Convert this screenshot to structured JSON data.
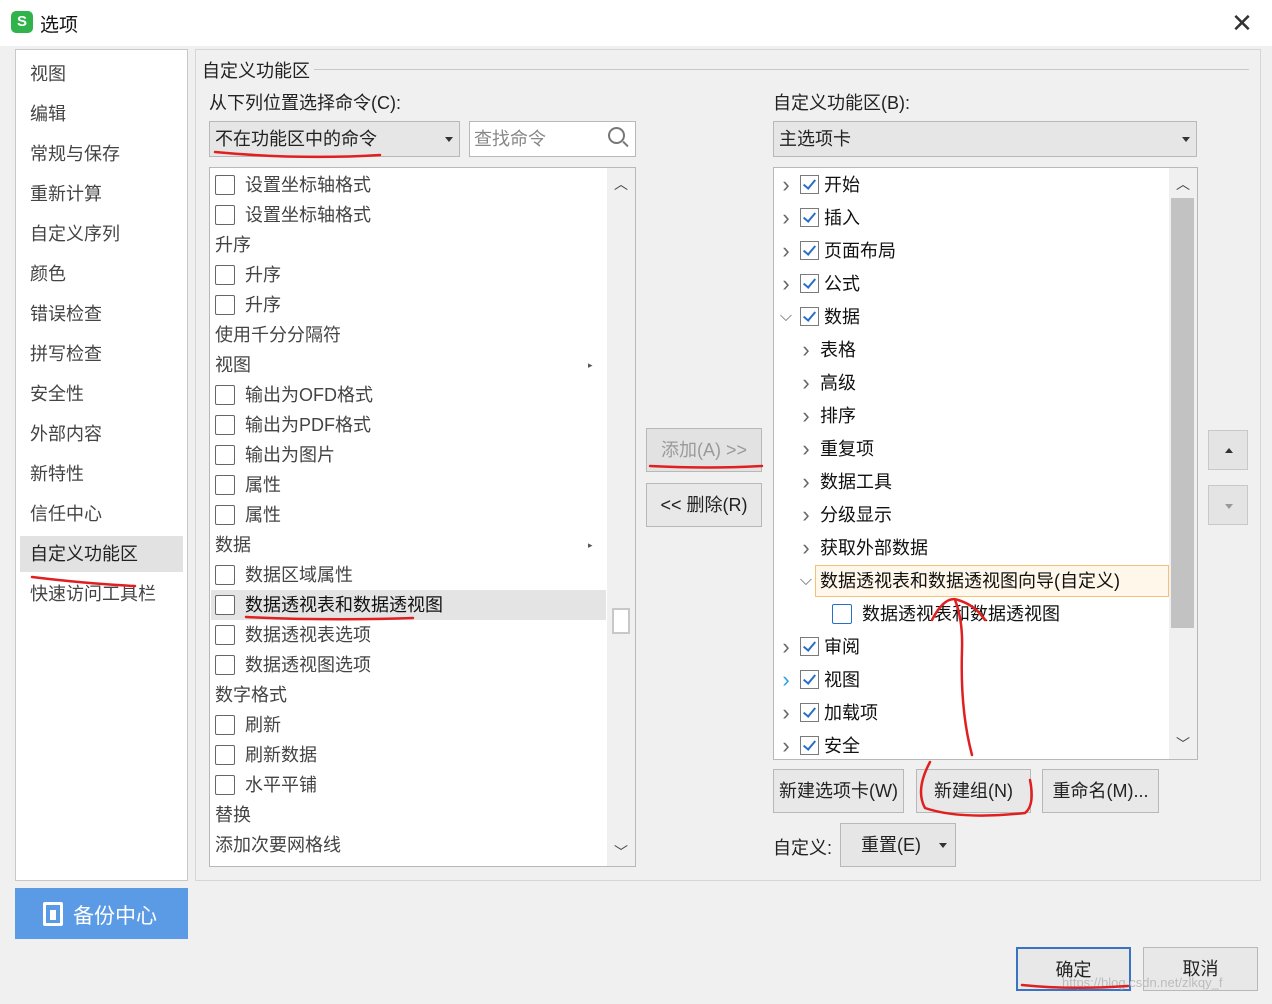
{
  "window": {
    "title": "选项",
    "app_icon_letter": "S",
    "close_glyph": "✕"
  },
  "nav": {
    "items": [
      "视图",
      "编辑",
      "常规与保存",
      "重新计算",
      "自定义序列",
      "颜色",
      "错误检查",
      "拼写检查",
      "安全性",
      "外部内容",
      "新特性",
      "信任中心",
      "自定义功能区",
      "快速访问工具栏"
    ],
    "active": "自定义功能区",
    "backup_label": "备份中心"
  },
  "section": {
    "title": "自定义功能区",
    "from_label": "从下列位置选择命令(C):",
    "from_value": "不在功能区中的命令",
    "search_placeholder": "查找命令",
    "ribbon_label": "自定义功能区(B):",
    "ribbon_value": "主选项卡"
  },
  "commands": [
    {
      "text": "设置坐标轴格式",
      "icon": "axis-format-icon"
    },
    {
      "text": "设置坐标轴格式",
      "icon": "axis-format-icon"
    },
    {
      "text": "升序",
      "icon": ""
    },
    {
      "text": "升序",
      "icon": "sort-ascending-icon"
    },
    {
      "text": "升序",
      "icon": "sort-ascending-icon"
    },
    {
      "text": "使用千分分隔符",
      "icon": ""
    },
    {
      "text": "视图",
      "icon": "",
      "submenu": true
    },
    {
      "text": "输出为OFD格式",
      "icon": "ofd-icon"
    },
    {
      "text": "输出为PDF格式",
      "icon": "pdf-icon"
    },
    {
      "text": "输出为图片",
      "icon": "picture-icon"
    },
    {
      "text": "属性",
      "icon": "properties-icon"
    },
    {
      "text": "属性",
      "icon": "properties-icon"
    },
    {
      "text": "数据",
      "icon": "",
      "submenu": true
    },
    {
      "text": "数据区域属性",
      "icon": "data-range-icon"
    },
    {
      "text": "数据透视表和数据透视图",
      "icon": "pivot-icon",
      "selected": true
    },
    {
      "text": "数据透视表选项",
      "icon": "pivot-table-icon"
    },
    {
      "text": "数据透视图选项",
      "icon": "pivot-chart-icon"
    },
    {
      "text": "数字格式",
      "icon": ""
    },
    {
      "text": "刷新",
      "icon": "refresh-icon"
    },
    {
      "text": "刷新数据",
      "icon": "refresh-data-icon"
    },
    {
      "text": "水平平铺",
      "icon": "tile-horizontal-icon"
    },
    {
      "text": "替换",
      "icon": ""
    },
    {
      "text": "添加次要网格线",
      "icon": ""
    }
  ],
  "buttons": {
    "add": "添加(A) >>",
    "remove": "<< 删除(R)",
    "new_tab": "新建选项卡(W)",
    "new_group": "新建组(N)",
    "rename": "重命名(M)...",
    "customize_label": "自定义:",
    "reset": "重置(E)",
    "ok": "确定",
    "cancel": "取消"
  },
  "tree": [
    {
      "text": "开始",
      "level": 0,
      "toggle": ">",
      "checked": true
    },
    {
      "text": "插入",
      "level": 0,
      "toggle": ">",
      "checked": true
    },
    {
      "text": "页面布局",
      "level": 0,
      "toggle": ">",
      "checked": true
    },
    {
      "text": "公式",
      "level": 0,
      "toggle": ">",
      "checked": true
    },
    {
      "text": "数据",
      "level": 0,
      "toggle": "v",
      "checked": true
    },
    {
      "text": "表格",
      "level": 1,
      "toggle": ">"
    },
    {
      "text": "高级",
      "level": 1,
      "toggle": ">"
    },
    {
      "text": "排序",
      "level": 1,
      "toggle": ">"
    },
    {
      "text": "重复项",
      "level": 1,
      "toggle": ">"
    },
    {
      "text": "数据工具",
      "level": 1,
      "toggle": ">"
    },
    {
      "text": "分级显示",
      "level": 1,
      "toggle": ">"
    },
    {
      "text": "获取外部数据",
      "level": 1,
      "toggle": ">"
    },
    {
      "text": "数据透视表和数据透视图向导(自定义)",
      "level": 1,
      "toggle": "v",
      "highlight": true
    },
    {
      "text": "数据透视表和数据透视图",
      "level": 2,
      "icon": "pivot-icon"
    },
    {
      "text": "审阅",
      "level": 0,
      "toggle": ">",
      "checked": true
    },
    {
      "text": "视图",
      "level": 0,
      "toggle": ">",
      "checked": true,
      "hover": true
    },
    {
      "text": "加载项",
      "level": 0,
      "toggle": ">",
      "checked": true
    },
    {
      "text": "安全",
      "level": 0,
      "toggle": ">",
      "checked": true
    }
  ],
  "watermark": "https://blog.csdn.net/zlkqy_f",
  "colors": {
    "accent": "#3a73c2",
    "backup": "#5b9be6",
    "annotation": "#e02020"
  }
}
